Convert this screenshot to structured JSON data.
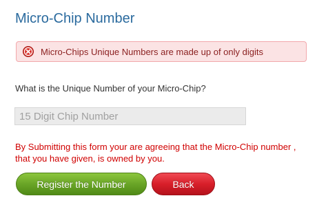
{
  "page": {
    "title": "Micro-Chip Number"
  },
  "error": {
    "icon": "error-circle-x-icon",
    "message": "Micro-Chips Unique Numbers are made up of only digits",
    "color": "#8a1f1f",
    "background": "#fbe3e4"
  },
  "form": {
    "question": "What is the Unique Number of your Micro-Chip?",
    "chip_input": {
      "value": "",
      "placeholder": "15 Digit Chip Number"
    },
    "disclaimer": "By Submitting this form your are agreeing that the Micro-Chip number , that you have given, is owned by you.",
    "disclaimer_color": "#d00000"
  },
  "buttons": {
    "register_label": "Register the Number",
    "register_color": "#6aa527",
    "back_label": "Back",
    "back_color": "#d81f2a"
  },
  "colors": {
    "title": "#2a6a9e"
  }
}
